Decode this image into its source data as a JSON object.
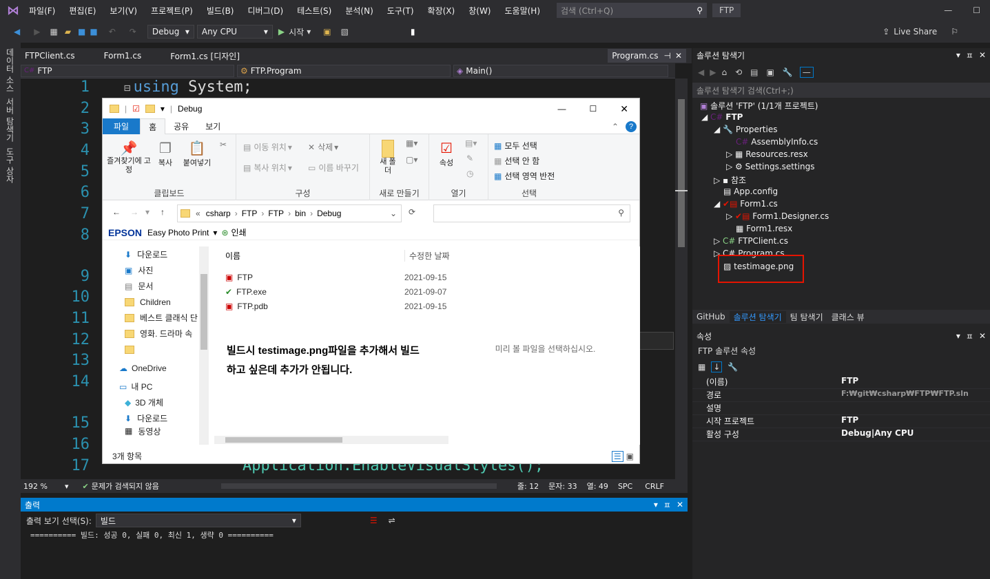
{
  "menu": [
    "파일(F)",
    "편집(E)",
    "보기(V)",
    "프로젝트(P)",
    "빌드(B)",
    "디버그(D)",
    "테스트(S)",
    "분석(N)",
    "도구(T)",
    "확장(X)",
    "창(W)",
    "도움말(H)"
  ],
  "search": {
    "placeholder": "검색 (Ctrl+Q)"
  },
  "solution_name": "FTP",
  "toolbar": {
    "config": "Debug",
    "platform": "Any CPU",
    "start": "시작",
    "liveshare": "Live Share"
  },
  "left_strip": [
    "데이터 소스",
    "서버 탐색기",
    "도구 상자"
  ],
  "tabs": [
    "FTPClient.cs",
    "Form1.cs",
    "Form1.cs [디자인]",
    "Program.cs"
  ],
  "nav": {
    "project": "FTP",
    "class": "FTP.Program",
    "member": "Main()"
  },
  "code": {
    "line1_kw": "using",
    "line1_rest": " System;",
    "line17": "Application.EnableVisualStyles();"
  },
  "line_numbers": [
    "1",
    "2",
    "3",
    "4",
    "5",
    "6",
    "7",
    "8",
    "9",
    "10",
    "11",
    "12",
    "13",
    "14",
    "15",
    "16",
    "17"
  ],
  "status": {
    "zoom": "192 %",
    "issues": "문제가 검색되지 않음",
    "line": "줄: 12",
    "char": "문자: 33",
    "col": "열: 49",
    "spc": "SPC",
    "crlf": "CRLF"
  },
  "output": {
    "title": "출력",
    "show_label": "출력 보기 선택(S):",
    "source": "빌드",
    "text": "========== 빌드: 성공 0, 실패 0, 최신 1, 생략 0 =========="
  },
  "solution_explorer": {
    "title": "솔루션 탐색기",
    "search": "솔루션 탐색기 검색(Ctrl+;)",
    "items": [
      "솔루션 'FTP' (1/1개 프로젝트)",
      "FTP",
      "Properties",
      "AssemblyInfo.cs",
      "Resources.resx",
      "Settings.settings",
      "참조",
      "App.config",
      "Form1.cs",
      "Form1.Designer.cs",
      "Form1.resx",
      "FTPClient.cs",
      "Program.cs",
      "testimage.png"
    ],
    "bottom_tabs": [
      "GitHub",
      "솔루션 탐색기",
      "팀 탐색기",
      "클래스 뷰"
    ]
  },
  "properties": {
    "title": "속성",
    "subject": "FTP 솔루션 속성",
    "rows": [
      {
        "k": "(이름)",
        "v": "FTP"
      },
      {
        "k": "경로",
        "v": "F:₩git₩csharp₩FTP₩FTP.sln"
      },
      {
        "k": "설명",
        "v": ""
      },
      {
        "k": "시작 프로젝트",
        "v": "FTP"
      },
      {
        "k": "활성 구성",
        "v": "Debug|Any CPU"
      }
    ]
  },
  "explorer": {
    "title": "Debug",
    "ribbon_tabs": [
      "파일",
      "홈",
      "공유",
      "보기"
    ],
    "clipboard": {
      "pin": "즐겨찾기에 고정",
      "copy": "복사",
      "paste": "붙여넣기",
      "label": "클립보드"
    },
    "organize": {
      "move": "이동 위치",
      "copy": "복사 위치",
      "delete": "삭제",
      "rename": "이름 바꾸기",
      "label": "구성"
    },
    "new": {
      "folder": "새 폴더",
      "label": "새로 만들기"
    },
    "open": {
      "props": "속성",
      "label": "열기"
    },
    "select": {
      "all": "모두 선택",
      "none": "선택 안 함",
      "invert": "선택 영역 반전",
      "label": "선택"
    },
    "path": [
      "«",
      "csharp",
      "FTP",
      "FTP",
      "bin",
      "Debug"
    ],
    "epson": "EPSON",
    "epson_app": "Easy Photo Print",
    "print": "인쇄",
    "nav_items": [
      "다운로드",
      "사진",
      "문서",
      "Children",
      "베스트 클래식 단",
      "영화. 드라마 속",
      "",
      "OneDrive",
      "내 PC",
      "3D 개체",
      "다운로드",
      "동영상"
    ],
    "col_name": "이름",
    "col_date": "수정한 날짜",
    "files": [
      {
        "name": "FTP",
        "date": "2021-09-15"
      },
      {
        "name": "FTP.exe",
        "date": "2021-09-07"
      },
      {
        "name": "FTP.pdb",
        "date": "2021-09-15"
      }
    ],
    "overlay_text1": "빌드시 testimage.png파일을 추가해서 빌드",
    "overlay_text2": "하고 싶은데 추가가 안됩니다.",
    "preview": "미리 볼 파일을 선택하십시오.",
    "status": "3개 항목"
  }
}
